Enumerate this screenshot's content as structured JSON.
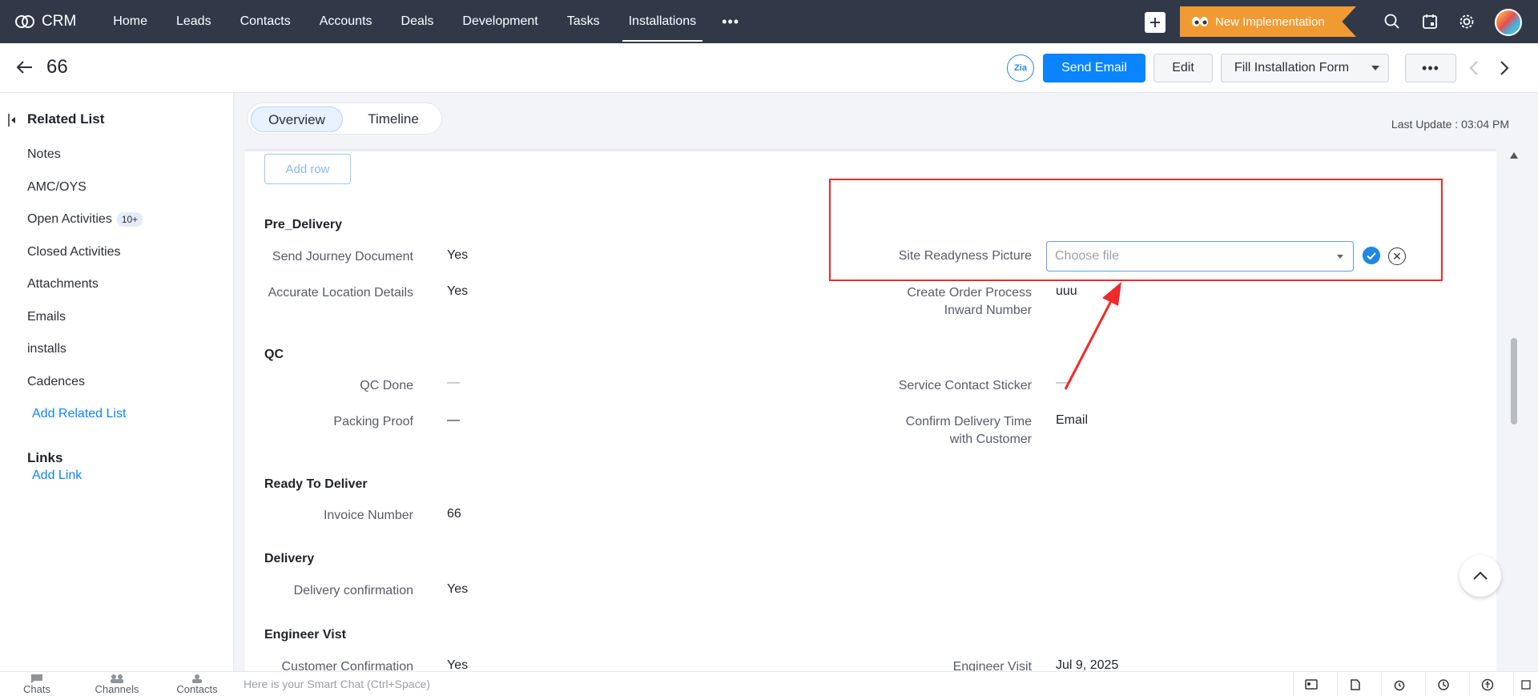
{
  "nav": {
    "app_name": "CRM",
    "tabs": [
      "Home",
      "Leads",
      "Contacts",
      "Accounts",
      "Deals",
      "Development",
      "Tasks",
      "Installations"
    ],
    "active_tab": "Installations",
    "new_implementation_label": "New Implementation"
  },
  "record": {
    "title": "66",
    "zia_label": "Zia",
    "send_email_label": "Send Email",
    "edit_label": "Edit",
    "fill_form_label": "Fill Installation Form"
  },
  "sidebar": {
    "related_title": "Related List",
    "items": [
      "Notes",
      "AMC/OYS",
      "Open Activities",
      "Closed Activities",
      "Attachments",
      "Emails",
      "installs",
      "Cadences"
    ],
    "open_activities_badge": "10+",
    "add_related_label": "Add Related List",
    "links_title": "Links",
    "add_link_label": "Add Link"
  },
  "tabs": {
    "overview": "Overview",
    "timeline": "Timeline",
    "last_update": "Last Update : 03:04 PM"
  },
  "content": {
    "add_row_label": "Add row",
    "sections": {
      "pre_delivery": "Pre_Delivery",
      "qc": "QC",
      "ready": "Ready To Deliver",
      "delivery": "Delivery",
      "engineer": "Engineer Vist"
    },
    "fields": {
      "send_journey_label": "Send Journey Document",
      "send_journey_value": "Yes",
      "accurate_location_label": "Accurate Location Details",
      "accurate_location_value": "Yes",
      "site_readyness_label": "Site Readyness Picture",
      "site_readyness_placeholder": "Choose file",
      "create_order_label_1": "Create Order Process",
      "create_order_label_2": "Inward Number",
      "create_order_value": "uuu",
      "qc_done_label": "QC Done",
      "qc_done_value": "—",
      "packing_proof_label": "Packing Proof",
      "packing_proof_value": "—",
      "service_sticker_label": "Service Contact Sticker",
      "service_sticker_value": "—",
      "confirm_delivery_label_1": "Confirm Delivery Time",
      "confirm_delivery_label_2": "with Customer",
      "confirm_delivery_value": "Email",
      "invoice_label": "Invoice Number",
      "invoice_value": "66",
      "delivery_conf_label": "Delivery confirmation",
      "delivery_conf_value": "Yes",
      "customer_conf_label": "Customer Confirmation",
      "customer_conf_value": "Yes",
      "engineer_visit_label": "Engineer Visit",
      "engineer_visit_value": "Jul 9, 2025"
    }
  },
  "bottom": {
    "chats": "Chats",
    "channels": "Channels",
    "contacts": "Contacts",
    "smart_chat": "Here is your Smart Chat (Ctrl+Space)"
  },
  "colors": {
    "nav_bg": "#313949",
    "primary": "#0a84ff",
    "accent_orange": "#f29a32",
    "annotation_red": "#ef2a2a"
  }
}
